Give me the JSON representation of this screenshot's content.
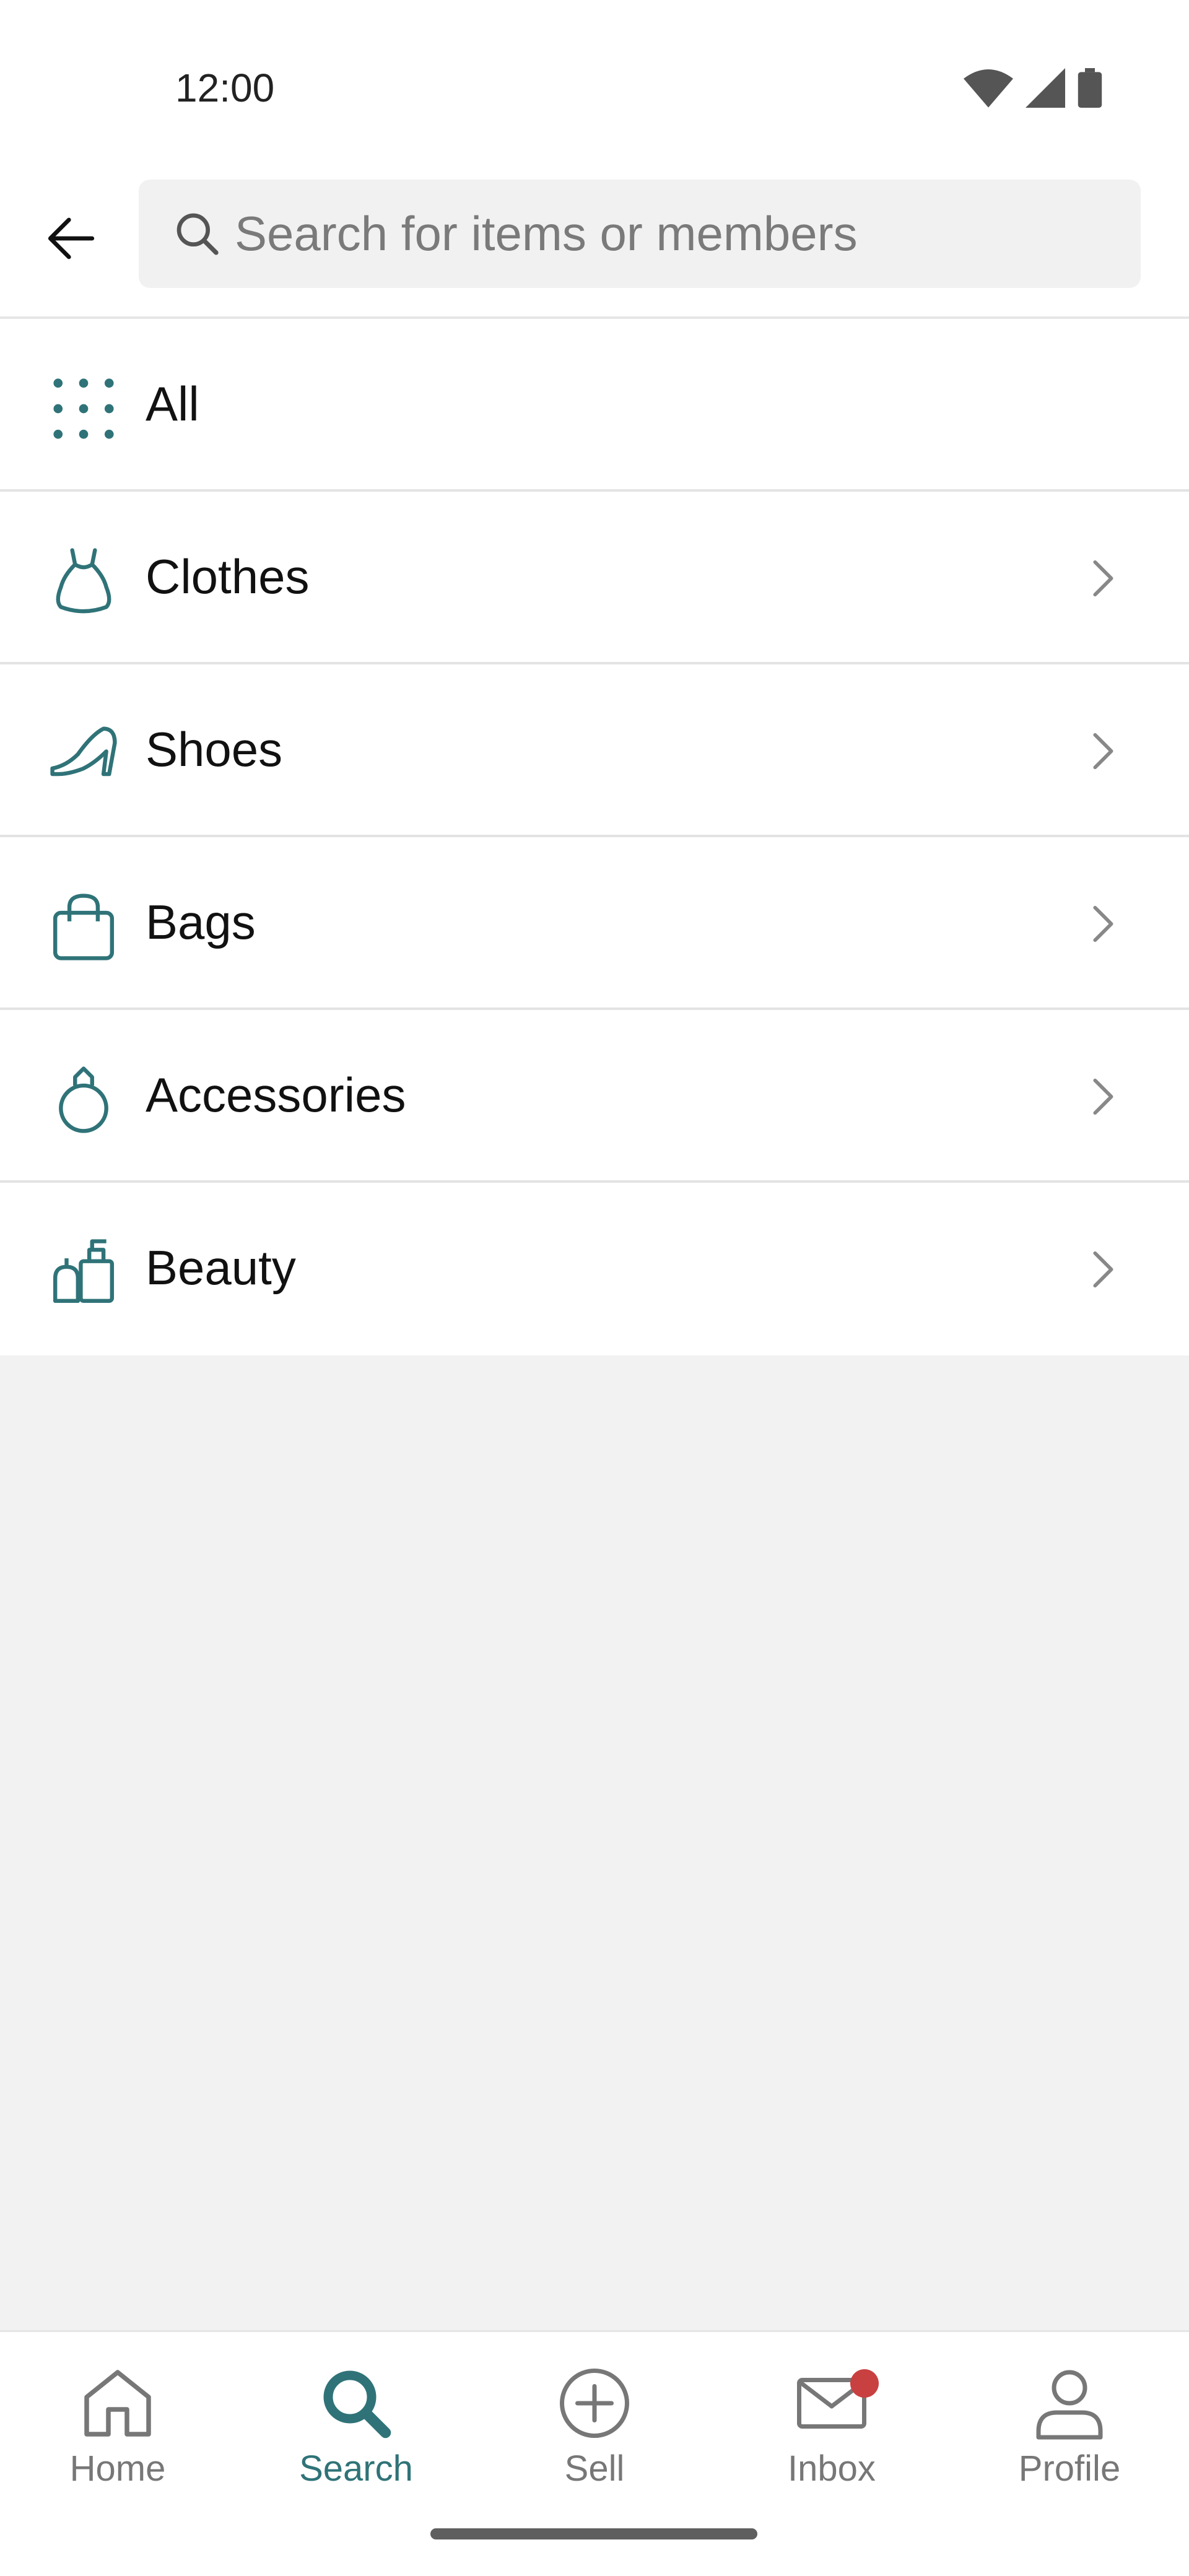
{
  "status_bar": {
    "time": "12:00"
  },
  "search": {
    "placeholder": "Search for items or members"
  },
  "categories": [
    {
      "label": "All",
      "icon": "grid-dots-icon",
      "has_chevron": false
    },
    {
      "label": "Clothes",
      "icon": "dress-icon",
      "has_chevron": true
    },
    {
      "label": "Shoes",
      "icon": "high-heel-icon",
      "has_chevron": true
    },
    {
      "label": "Bags",
      "icon": "bag-icon",
      "has_chevron": true
    },
    {
      "label": "Accessories",
      "icon": "ring-icon",
      "has_chevron": true
    },
    {
      "label": "Beauty",
      "icon": "perfume-icon",
      "has_chevron": true
    }
  ],
  "bottom_nav": {
    "items": [
      {
        "label": "Home",
        "icon": "home-icon",
        "active": false
      },
      {
        "label": "Search",
        "icon": "search-icon",
        "active": true
      },
      {
        "label": "Sell",
        "icon": "plus-circle-icon",
        "active": false
      },
      {
        "label": "Inbox",
        "icon": "mail-icon",
        "active": false,
        "badge": true
      },
      {
        "label": "Profile",
        "icon": "user-icon",
        "active": false
      }
    ]
  },
  "colors": {
    "accent": "#2f7378",
    "inactive": "#777777",
    "badge": "#c94040",
    "background": "#f2f2f2"
  }
}
